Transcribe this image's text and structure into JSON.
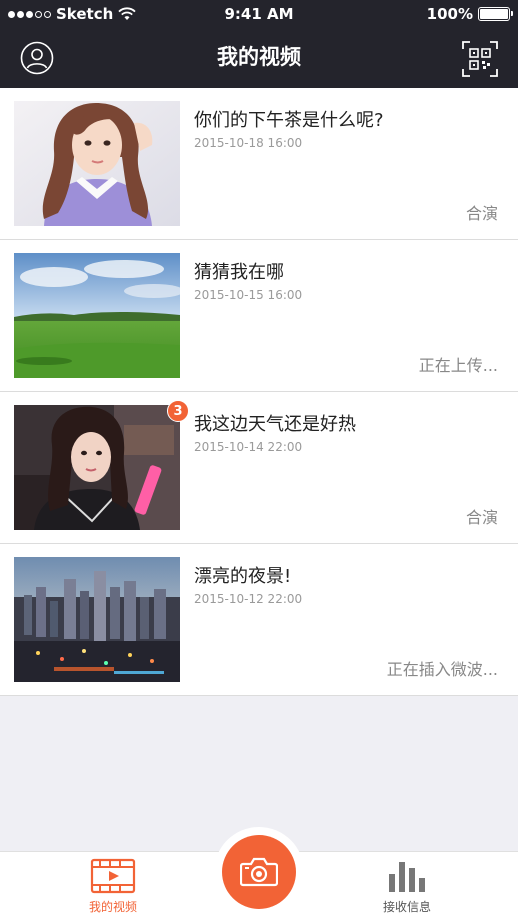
{
  "status_bar": {
    "carrier": "Sketch",
    "time": "9:41 AM",
    "battery": "100%"
  },
  "header": {
    "title": "我的视频"
  },
  "videos": [
    {
      "title": "你们的下午茶是什么呢?",
      "date": "2015-10-18 16:00",
      "status": "合演",
      "badge": ""
    },
    {
      "title": "猜猜我在哪",
      "date": "2015-10-15 16:00",
      "status": "正在上传...",
      "badge": ""
    },
    {
      "title": "我这边天气还是好热",
      "date": "2015-10-14 22:00",
      "status": "合演",
      "badge": "3"
    },
    {
      "title": "漂亮的夜景!",
      "date": "2015-10-12 22:00",
      "status": "正在插入微波...",
      "badge": ""
    }
  ],
  "tabbar": {
    "videos_label": "我的视频",
    "messages_label": "接收信息",
    "accent_color": "#f26336"
  },
  "icons": {
    "profile": "profile-icon",
    "qr": "qr-code-icon",
    "videos_tab": "film-icon",
    "camera": "camera-icon",
    "messages_tab": "bar-chart-icon"
  }
}
